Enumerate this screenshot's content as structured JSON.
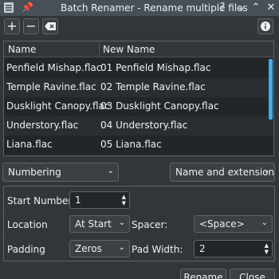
{
  "window": {
    "title": "Batch Renamer - Rename multiple files",
    "icons": {
      "app": "document-icon",
      "pin": "pin-icon",
      "help": "question-icon",
      "minimize": "chevron-down-icon",
      "maximize": "chevron-up-icon",
      "close": "close-icon"
    }
  },
  "toolbar": {
    "add_label": "+",
    "remove_label": "−",
    "clear_icon": "clear-icon",
    "info_icon": "info-icon"
  },
  "table": {
    "columns": [
      "Name",
      "New Name"
    ],
    "rows": [
      {
        "name": "Penfield Mishap.flac",
        "new_name": "01 Penfield Mishap.flac"
      },
      {
        "name": "Temple Ravine.flac",
        "new_name": "02 Temple Ravine.flac"
      },
      {
        "name": "Dusklight Canopy.flac",
        "new_name": "03 Dusklight Canopy.flac"
      },
      {
        "name": "Understory.flac",
        "new_name": "04 Understory.flac"
      },
      {
        "name": "Liana.flac",
        "new_name": "05 Liana.flac"
      }
    ]
  },
  "mode_combo": "Numbering",
  "scope_combo": "Name and extension",
  "options": {
    "start_number_label": "Start Number",
    "start_number_value": "1",
    "location_label": "Location",
    "location_value": "At Start",
    "spacer_label": "Spacer:",
    "spacer_value": "<Space>",
    "padding_label": "Padding",
    "padding_value": "Zeros",
    "pad_width_label": "Pad Width:",
    "pad_width_value": "2"
  },
  "buttons": {
    "rename": "Rename",
    "close": "Close"
  },
  "colors": {
    "accent": "#3daee9",
    "window_bg": "#31363b",
    "titlebar_bg": "#475057"
  }
}
